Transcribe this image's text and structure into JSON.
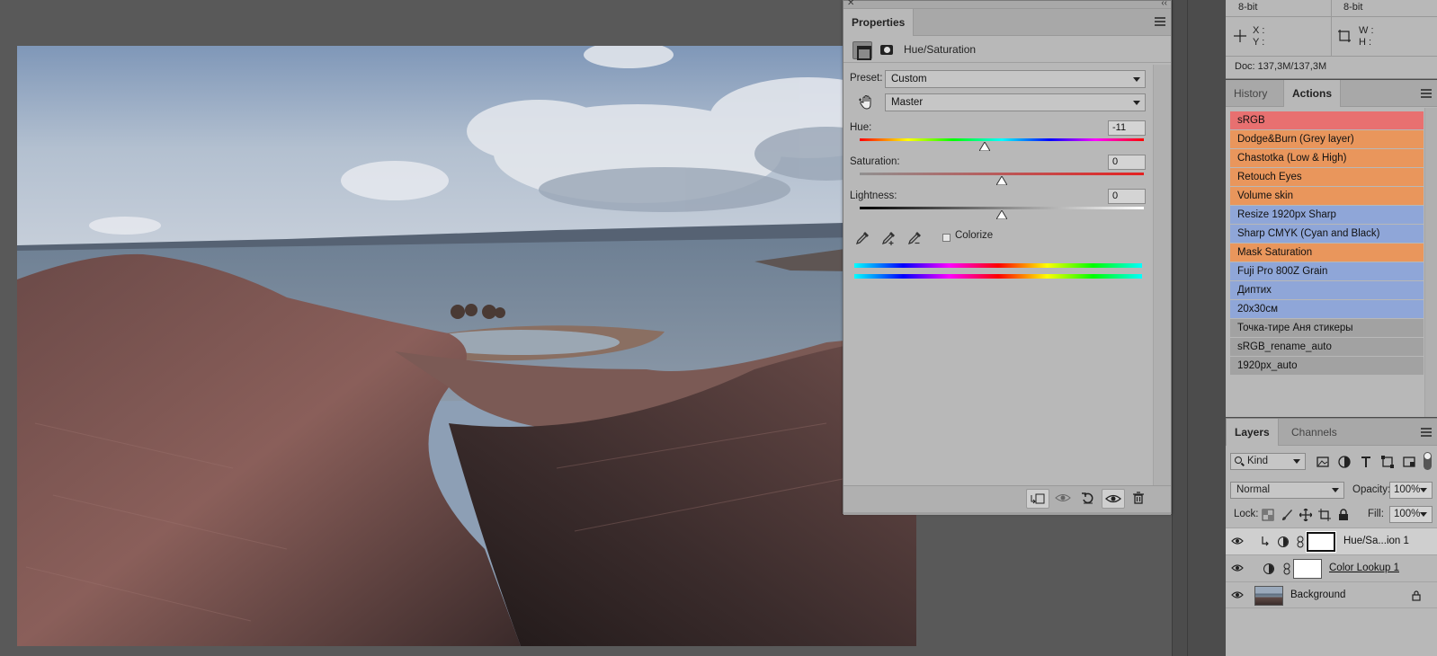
{
  "properties": {
    "tab_label": "Properties",
    "adjustment_title": "Hue/Saturation",
    "preset_label": "Preset:",
    "preset_value": "Custom",
    "channel_value": "Master",
    "hue_label": "Hue:",
    "hue_value": "-11",
    "saturation_label": "Saturation:",
    "saturation_value": "0",
    "lightness_label": "Lightness:",
    "lightness_value": "0",
    "colorize_label": "Colorize",
    "colorize_checked": false,
    "hue_slider_fraction": 0.44,
    "saturation_slider_fraction": 0.5,
    "lightness_slider_fraction": 0.5
  },
  "info": {
    "bits_left": "8-bit",
    "bits_right": "8-bit",
    "x_label": "X :",
    "y_label": "Y :",
    "w_label": "W :",
    "h_label": "H :",
    "doc_size": "Doc: 137,3M/137,3M"
  },
  "history_panel": {
    "tab_history": "History",
    "tab_actions": "Actions",
    "actions": [
      {
        "label": "sRGB",
        "color": "#e87070"
      },
      {
        "label": "Dodge&Burn (Grey layer)",
        "color": "#e9965c"
      },
      {
        "label": "Chastotka (Low & High)",
        "color": "#e9965c"
      },
      {
        "label": "Retouch Eyes",
        "color": "#e9965c"
      },
      {
        "label": "Volume skin",
        "color": "#e9965c"
      },
      {
        "label": "Resize 1920px Sharp",
        "color": "#8fa6d8"
      },
      {
        "label": "Sharp CMYK (Cyan and Black)",
        "color": "#8fa6d8"
      },
      {
        "label": "Mask Saturation",
        "color": "#e9965c"
      },
      {
        "label": "Fuji Pro 800Z Grain",
        "color": "#8fa6d8"
      },
      {
        "label": "Диптих",
        "color": "#8fa6d8"
      },
      {
        "label": "20x30см",
        "color": "#8fa6d8"
      },
      {
        "label": "Точка-тире Аня стикеры",
        "color": "#a2a2a2"
      },
      {
        "label": "sRGB_rename_auto",
        "color": "#a2a2a2"
      },
      {
        "label": "1920px_auto",
        "color": "#a2a2a2"
      }
    ]
  },
  "layers_panel": {
    "tab_layers": "Layers",
    "tab_channels": "Channels",
    "kind_label": "Kind",
    "blend_mode": "Normal",
    "opacity_label": "Opacity:",
    "opacity_value": "100%",
    "lock_label": "Lock:",
    "fill_label": "Fill:",
    "fill_value": "100%",
    "layers": [
      {
        "name": "Hue/Sa...ion 1",
        "selected": true
      },
      {
        "name": "Color Lookup 1",
        "selected": false
      },
      {
        "name": "Background",
        "selected": false
      }
    ]
  }
}
